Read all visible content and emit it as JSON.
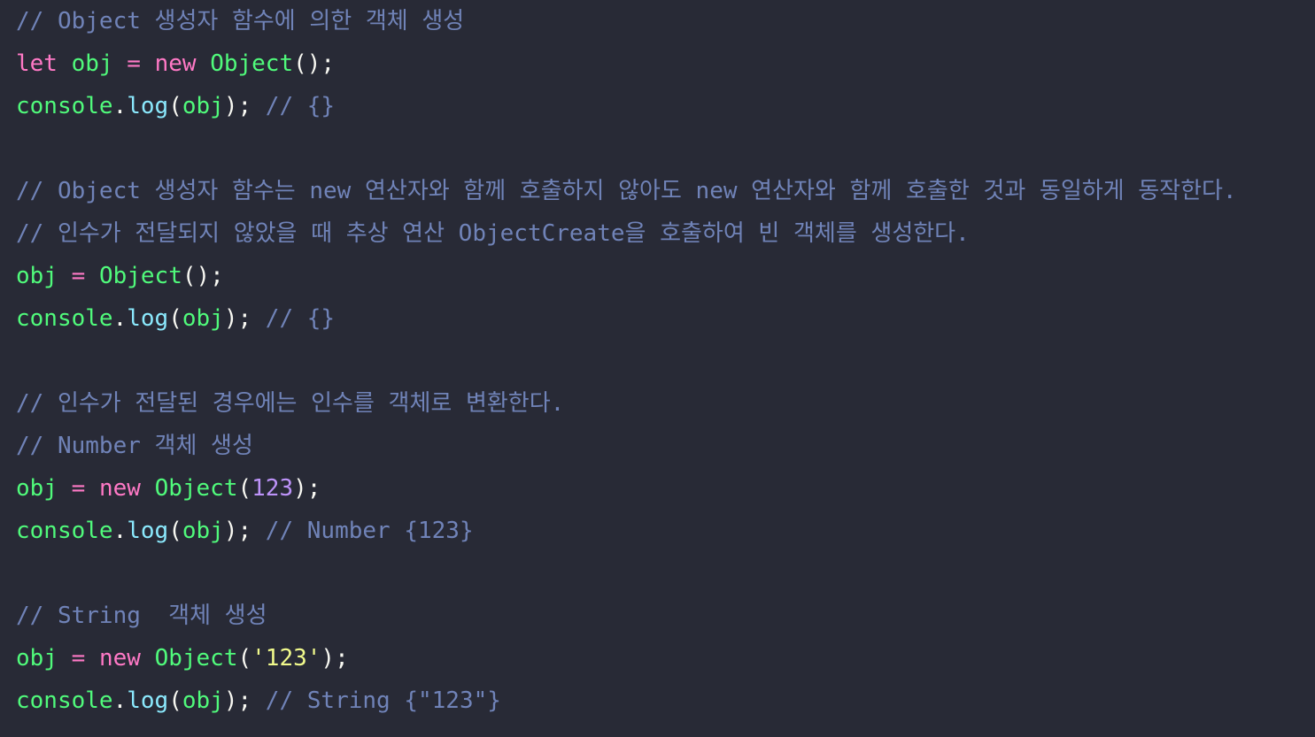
{
  "colors": {
    "background": "#282a36",
    "comment": "#7083b8",
    "keyword": "#ff79c6",
    "variable": "#50fa7b",
    "function": "#8be9fd",
    "punctuation": "#f8f8f2",
    "number": "#bd93f9",
    "string": "#f1fa8c"
  },
  "lines": [
    [
      {
        "t": "// Object 생성자 함수에 의한 객체 생성",
        "c": "comment"
      }
    ],
    [
      {
        "t": "let",
        "c": "keyword"
      },
      {
        "t": " "
      },
      {
        "t": "obj",
        "c": "var"
      },
      {
        "t": " "
      },
      {
        "t": "=",
        "c": "op"
      },
      {
        "t": " "
      },
      {
        "t": "new",
        "c": "keyword"
      },
      {
        "t": " "
      },
      {
        "t": "Object",
        "c": "class"
      },
      {
        "t": "();",
        "c": "punc"
      }
    ],
    [
      {
        "t": "console",
        "c": "var"
      },
      {
        "t": ".",
        "c": "punc"
      },
      {
        "t": "log",
        "c": "fn"
      },
      {
        "t": "(",
        "c": "punc"
      },
      {
        "t": "obj",
        "c": "var"
      },
      {
        "t": ");",
        "c": "punc"
      },
      {
        "t": " "
      },
      {
        "t": "// {}",
        "c": "comment"
      }
    ],
    [],
    [
      {
        "t": "// Object 생성자 함수는 new 연산자와 함께 호출하지 않아도 new 연산자와 함께 호출한 것과 동일하게 동작한다.",
        "c": "comment"
      }
    ],
    [
      {
        "t": "// 인수가 전달되지 않았을 때 추상 연산 ObjectCreate을 호출하여 빈 객체를 생성한다.",
        "c": "comment"
      }
    ],
    [
      {
        "t": "obj",
        "c": "var"
      },
      {
        "t": " "
      },
      {
        "t": "=",
        "c": "op"
      },
      {
        "t": " "
      },
      {
        "t": "Object",
        "c": "class"
      },
      {
        "t": "();",
        "c": "punc"
      }
    ],
    [
      {
        "t": "console",
        "c": "var"
      },
      {
        "t": ".",
        "c": "punc"
      },
      {
        "t": "log",
        "c": "fn"
      },
      {
        "t": "(",
        "c": "punc"
      },
      {
        "t": "obj",
        "c": "var"
      },
      {
        "t": ");",
        "c": "punc"
      },
      {
        "t": " "
      },
      {
        "t": "// {}",
        "c": "comment"
      }
    ],
    [],
    [
      {
        "t": "// 인수가 전달된 경우에는 인수를 객체로 변환한다.",
        "c": "comment"
      }
    ],
    [
      {
        "t": "// Number 객체 생성",
        "c": "comment"
      }
    ],
    [
      {
        "t": "obj",
        "c": "var"
      },
      {
        "t": " "
      },
      {
        "t": "=",
        "c": "op"
      },
      {
        "t": " "
      },
      {
        "t": "new",
        "c": "keyword"
      },
      {
        "t": " "
      },
      {
        "t": "Object",
        "c": "class"
      },
      {
        "t": "(",
        "c": "punc"
      },
      {
        "t": "123",
        "c": "num"
      },
      {
        "t": ");",
        "c": "punc"
      }
    ],
    [
      {
        "t": "console",
        "c": "var"
      },
      {
        "t": ".",
        "c": "punc"
      },
      {
        "t": "log",
        "c": "fn"
      },
      {
        "t": "(",
        "c": "punc"
      },
      {
        "t": "obj",
        "c": "var"
      },
      {
        "t": ");",
        "c": "punc"
      },
      {
        "t": " "
      },
      {
        "t": "// Number {123}",
        "c": "comment"
      }
    ],
    [],
    [
      {
        "t": "// String  객체 생성",
        "c": "comment"
      }
    ],
    [
      {
        "t": "obj",
        "c": "var"
      },
      {
        "t": " "
      },
      {
        "t": "=",
        "c": "op"
      },
      {
        "t": " "
      },
      {
        "t": "new",
        "c": "keyword"
      },
      {
        "t": " "
      },
      {
        "t": "Object",
        "c": "class"
      },
      {
        "t": "(",
        "c": "punc"
      },
      {
        "t": "'123'",
        "c": "str"
      },
      {
        "t": ");",
        "c": "punc"
      }
    ],
    [
      {
        "t": "console",
        "c": "var"
      },
      {
        "t": ".",
        "c": "punc"
      },
      {
        "t": "log",
        "c": "fn"
      },
      {
        "t": "(",
        "c": "punc"
      },
      {
        "t": "obj",
        "c": "var"
      },
      {
        "t": ");",
        "c": "punc"
      },
      {
        "t": " "
      },
      {
        "t": "// String {\"123\"}",
        "c": "comment"
      }
    ]
  ]
}
